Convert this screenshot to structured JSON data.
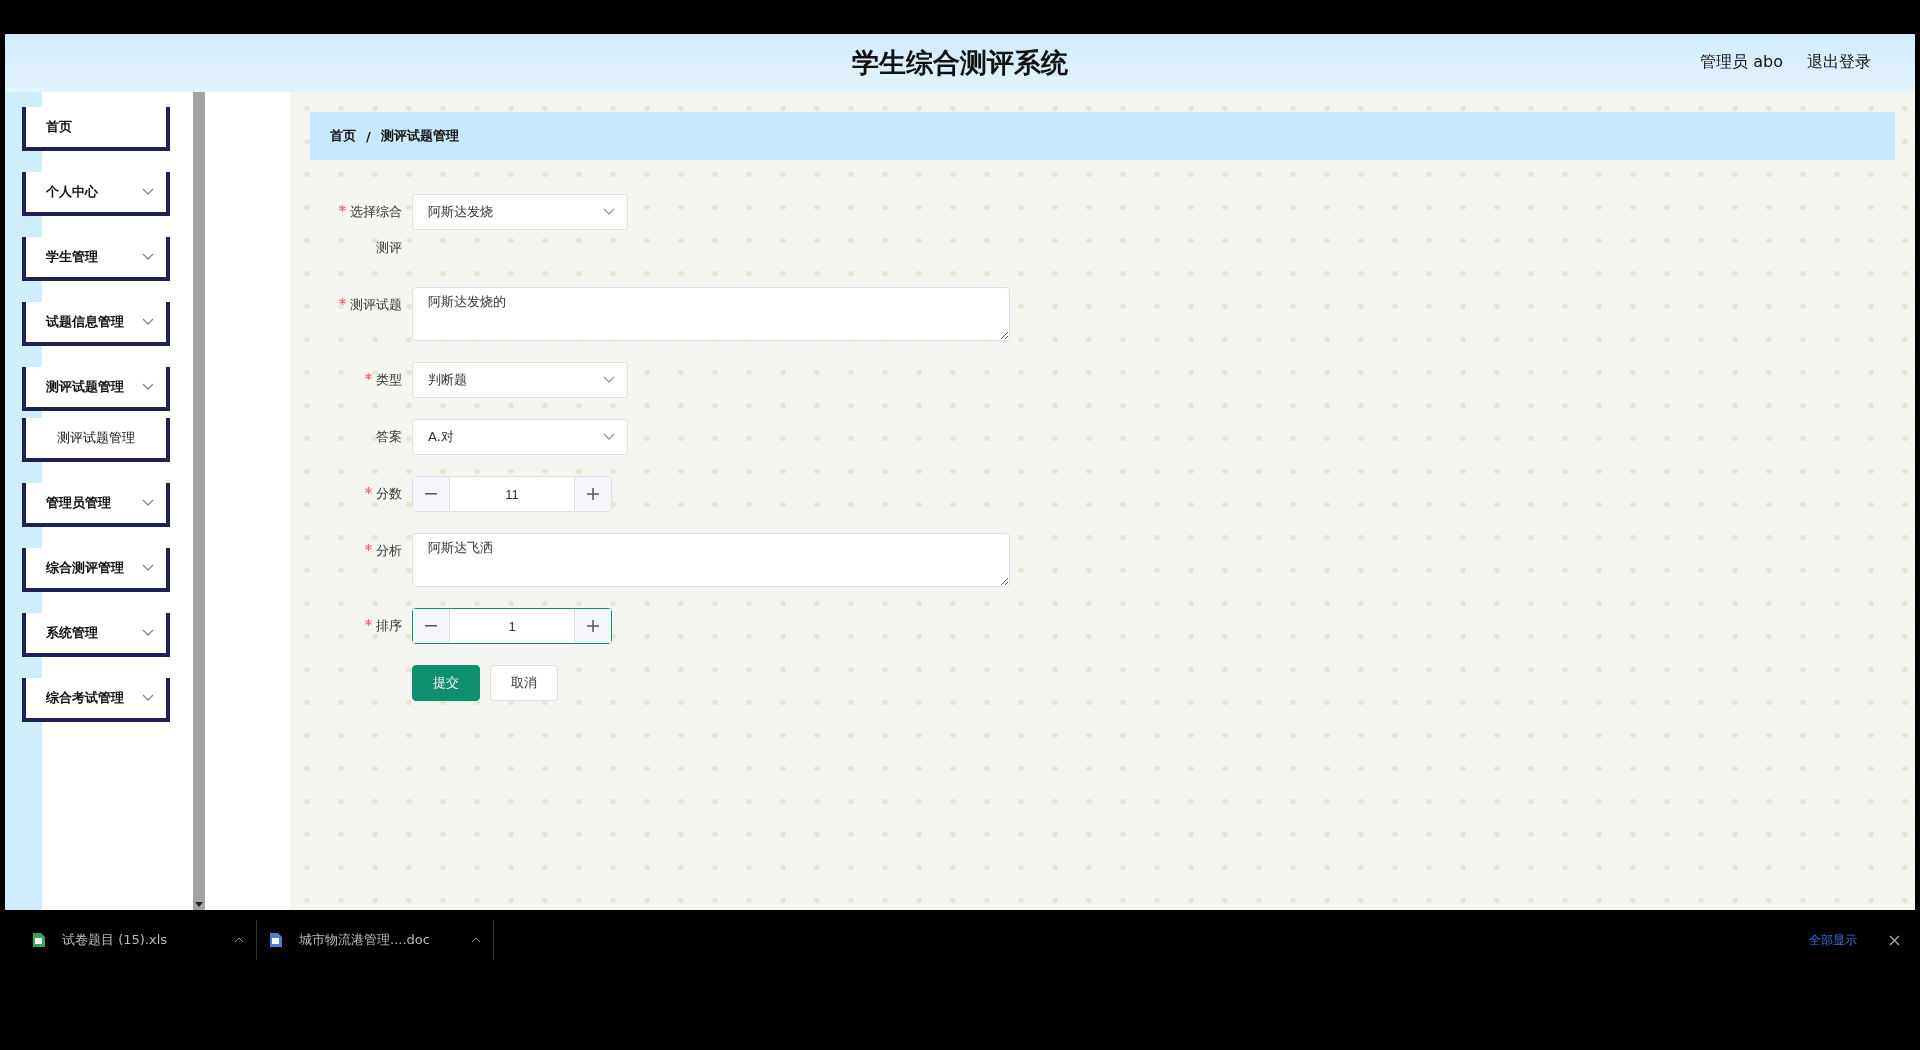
{
  "header": {
    "title": "学生综合测评系统",
    "user": "管理员 abo",
    "logout": "退出登录"
  },
  "sidebar": {
    "items": [
      {
        "label": "首页",
        "expandable": false
      },
      {
        "label": "个人中心",
        "expandable": true
      },
      {
        "label": "学生管理",
        "expandable": true
      },
      {
        "label": "试题信息管理",
        "expandable": true
      },
      {
        "label": "测评试题管理",
        "expandable": true,
        "children": [
          {
            "label": "测评试题管理"
          }
        ]
      },
      {
        "label": "管理员管理",
        "expandable": true
      },
      {
        "label": "综合测评管理",
        "expandable": true
      },
      {
        "label": "系统管理",
        "expandable": true
      },
      {
        "label": "综合考试管理",
        "expandable": true
      }
    ]
  },
  "breadcrumb": {
    "separator": "/",
    "items": [
      "首页",
      "测评试题管理"
    ]
  },
  "form": {
    "fields": [
      {
        "kind": "select",
        "label": "选择综合测评",
        "required": true,
        "value": "阿斯达发烧",
        "focused": false
      },
      {
        "kind": "textarea",
        "label": "测评试题",
        "required": true,
        "value": "阿斯达发烧的",
        "focused": false
      },
      {
        "kind": "select",
        "label": "类型",
        "required": true,
        "value": "判断题",
        "focused": false
      },
      {
        "kind": "select",
        "label": "答案",
        "required": false,
        "value": "A.对",
        "focused": false
      },
      {
        "kind": "number",
        "label": "分数",
        "required": true,
        "value": "11",
        "focused": false
      },
      {
        "kind": "textarea",
        "label": "分析",
        "required": true,
        "value": "阿斯达飞洒",
        "focused": false
      },
      {
        "kind": "number",
        "label": "排序",
        "required": true,
        "value": "1",
        "focused": true
      }
    ],
    "buttons": [
      {
        "kind": "primary",
        "label": "提交"
      },
      {
        "kind": "default",
        "label": "取消"
      }
    ]
  },
  "downloads": {
    "items": [
      {
        "kind": "sheet",
        "name": "试卷题目 (15).xls"
      },
      {
        "kind": "doc",
        "name": "城市物流港管理....doc"
      }
    ],
    "show_all": "全部显示"
  }
}
